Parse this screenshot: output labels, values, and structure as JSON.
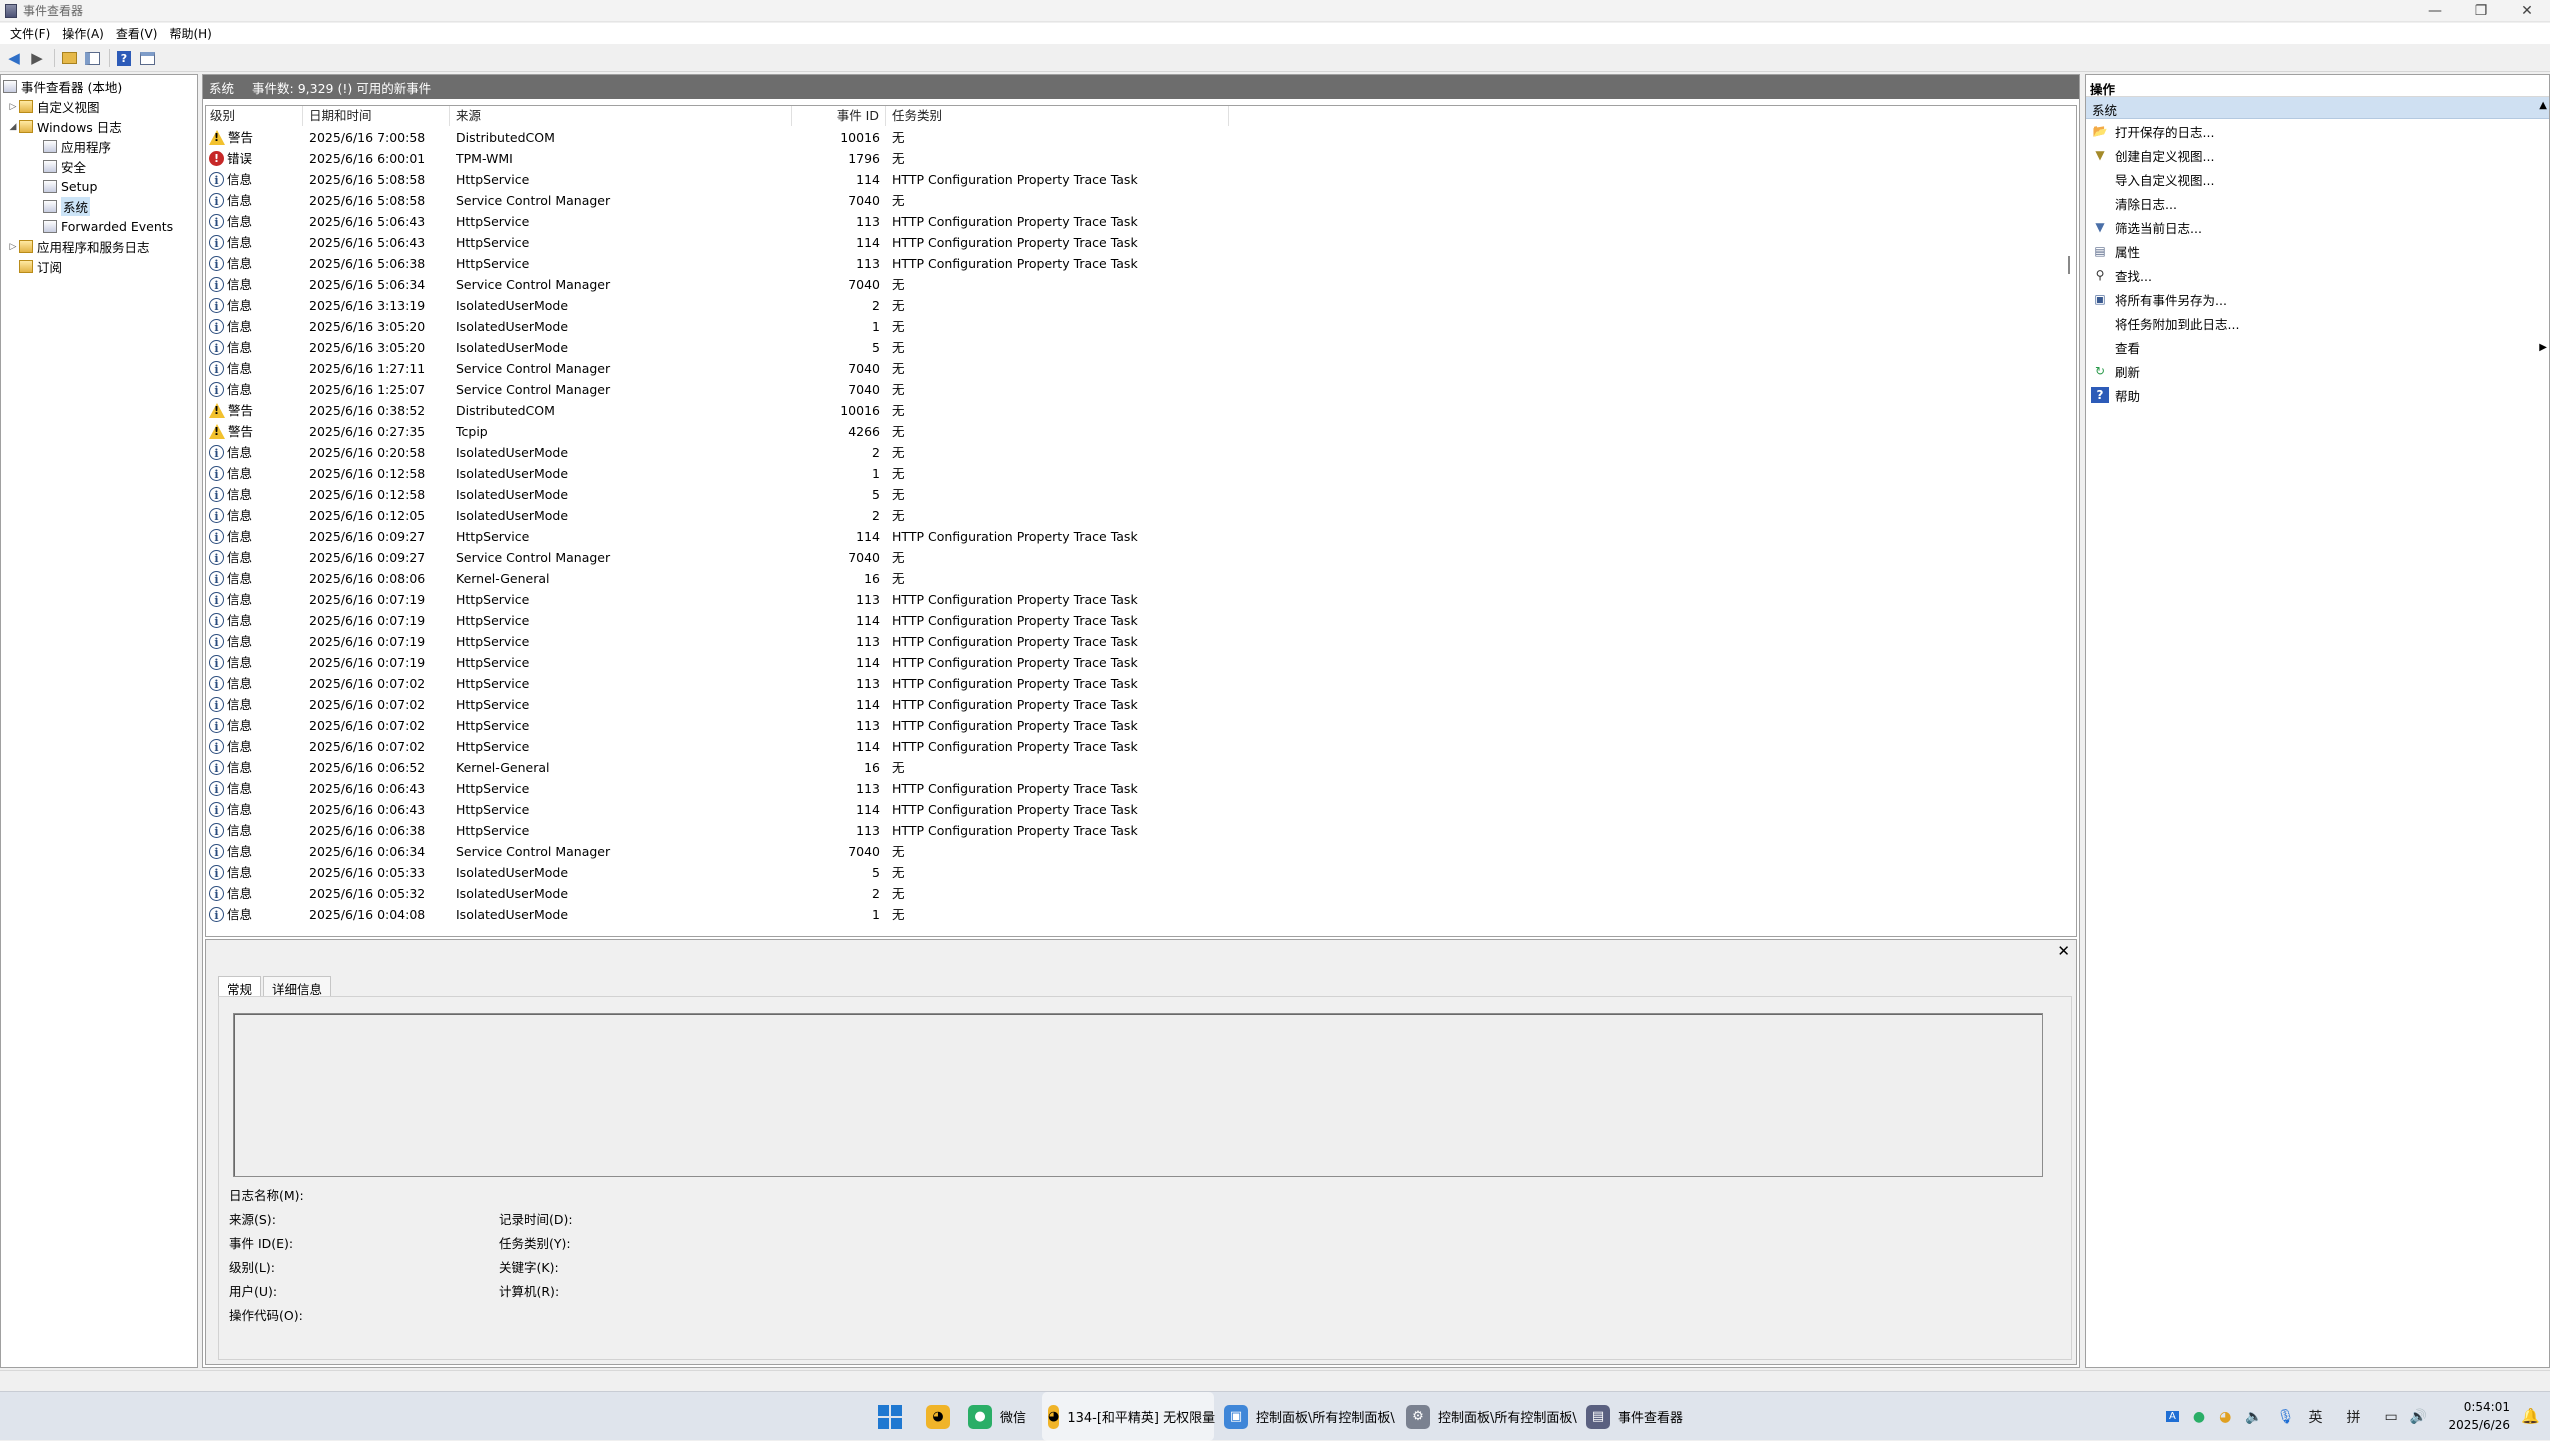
{
  "window": {
    "title": "事件查看器",
    "min": "—",
    "restore": "❐",
    "close": "✕"
  },
  "menu": [
    "文件(F)",
    "操作(A)",
    "查看(V)",
    "帮助(H)"
  ],
  "tree": {
    "root": "事件查看器 (本地)",
    "custom_views": "自定义视图",
    "windows_logs": "Windows 日志",
    "app": "应用程序",
    "security": "安全",
    "setup": "Setup",
    "system": "系统",
    "forwarded": "Forwarded Events",
    "app_services": "应用程序和服务日志",
    "subscriptions": "订阅"
  },
  "center": {
    "log_name": "系统",
    "summary": "事件数: 9,329 (!) 可用的新事件"
  },
  "columns": {
    "level": "级别",
    "datetime": "日期和时间",
    "source": "来源",
    "event_id": "事件 ID",
    "task": "任务类别"
  },
  "events": [
    {
      "level": "警告",
      "type": "warn",
      "datetime": "2025/6/16 7:00:58",
      "source": "DistributedCOM",
      "id": "10016",
      "task": "无"
    },
    {
      "level": "错误",
      "type": "err",
      "datetime": "2025/6/16 6:00:01",
      "source": "TPM-WMI",
      "id": "1796",
      "task": "无"
    },
    {
      "level": "信息",
      "type": "info",
      "datetime": "2025/6/16 5:08:58",
      "source": "HttpService",
      "id": "114",
      "task": "HTTP Configuration Property Trace Task"
    },
    {
      "level": "信息",
      "type": "info",
      "datetime": "2025/6/16 5:08:58",
      "source": "Service Control Manager",
      "id": "7040",
      "task": "无"
    },
    {
      "level": "信息",
      "type": "info",
      "datetime": "2025/6/16 5:06:43",
      "source": "HttpService",
      "id": "113",
      "task": "HTTP Configuration Property Trace Task"
    },
    {
      "level": "信息",
      "type": "info",
      "datetime": "2025/6/16 5:06:43",
      "source": "HttpService",
      "id": "114",
      "task": "HTTP Configuration Property Trace Task"
    },
    {
      "level": "信息",
      "type": "info",
      "datetime": "2025/6/16 5:06:38",
      "source": "HttpService",
      "id": "113",
      "task": "HTTP Configuration Property Trace Task"
    },
    {
      "level": "信息",
      "type": "info",
      "datetime": "2025/6/16 5:06:34",
      "source": "Service Control Manager",
      "id": "7040",
      "task": "无"
    },
    {
      "level": "信息",
      "type": "info",
      "datetime": "2025/6/16 3:13:19",
      "source": "IsolatedUserMode",
      "id": "2",
      "task": "无"
    },
    {
      "level": "信息",
      "type": "info",
      "datetime": "2025/6/16 3:05:20",
      "source": "IsolatedUserMode",
      "id": "1",
      "task": "无"
    },
    {
      "level": "信息",
      "type": "info",
      "datetime": "2025/6/16 3:05:20",
      "source": "IsolatedUserMode",
      "id": "5",
      "task": "无"
    },
    {
      "level": "信息",
      "type": "info",
      "datetime": "2025/6/16 1:27:11",
      "source": "Service Control Manager",
      "id": "7040",
      "task": "无"
    },
    {
      "level": "信息",
      "type": "info",
      "datetime": "2025/6/16 1:25:07",
      "source": "Service Control Manager",
      "id": "7040",
      "task": "无"
    },
    {
      "level": "警告",
      "type": "warn",
      "datetime": "2025/6/16 0:38:52",
      "source": "DistributedCOM",
      "id": "10016",
      "task": "无"
    },
    {
      "level": "警告",
      "type": "warn",
      "datetime": "2025/6/16 0:27:35",
      "source": "Tcpip",
      "id": "4266",
      "task": "无"
    },
    {
      "level": "信息",
      "type": "info",
      "datetime": "2025/6/16 0:20:58",
      "source": "IsolatedUserMode",
      "id": "2",
      "task": "无"
    },
    {
      "level": "信息",
      "type": "info",
      "datetime": "2025/6/16 0:12:58",
      "source": "IsolatedUserMode",
      "id": "1",
      "task": "无"
    },
    {
      "level": "信息",
      "type": "info",
      "datetime": "2025/6/16 0:12:58",
      "source": "IsolatedUserMode",
      "id": "5",
      "task": "无"
    },
    {
      "level": "信息",
      "type": "info",
      "datetime": "2025/6/16 0:12:05",
      "source": "IsolatedUserMode",
      "id": "2",
      "task": "无"
    },
    {
      "level": "信息",
      "type": "info",
      "datetime": "2025/6/16 0:09:27",
      "source": "HttpService",
      "id": "114",
      "task": "HTTP Configuration Property Trace Task"
    },
    {
      "level": "信息",
      "type": "info",
      "datetime": "2025/6/16 0:09:27",
      "source": "Service Control Manager",
      "id": "7040",
      "task": "无"
    },
    {
      "level": "信息",
      "type": "info",
      "datetime": "2025/6/16 0:08:06",
      "source": "Kernel-General",
      "id": "16",
      "task": "无"
    },
    {
      "level": "信息",
      "type": "info",
      "datetime": "2025/6/16 0:07:19",
      "source": "HttpService",
      "id": "113",
      "task": "HTTP Configuration Property Trace Task"
    },
    {
      "level": "信息",
      "type": "info",
      "datetime": "2025/6/16 0:07:19",
      "source": "HttpService",
      "id": "114",
      "task": "HTTP Configuration Property Trace Task"
    },
    {
      "level": "信息",
      "type": "info",
      "datetime": "2025/6/16 0:07:19",
      "source": "HttpService",
      "id": "113",
      "task": "HTTP Configuration Property Trace Task"
    },
    {
      "level": "信息",
      "type": "info",
      "datetime": "2025/6/16 0:07:19",
      "source": "HttpService",
      "id": "114",
      "task": "HTTP Configuration Property Trace Task"
    },
    {
      "level": "信息",
      "type": "info",
      "datetime": "2025/6/16 0:07:02",
      "source": "HttpService",
      "id": "113",
      "task": "HTTP Configuration Property Trace Task"
    },
    {
      "level": "信息",
      "type": "info",
      "datetime": "2025/6/16 0:07:02",
      "source": "HttpService",
      "id": "114",
      "task": "HTTP Configuration Property Trace Task"
    },
    {
      "level": "信息",
      "type": "info",
      "datetime": "2025/6/16 0:07:02",
      "source": "HttpService",
      "id": "113",
      "task": "HTTP Configuration Property Trace Task"
    },
    {
      "level": "信息",
      "type": "info",
      "datetime": "2025/6/16 0:07:02",
      "source": "HttpService",
      "id": "114",
      "task": "HTTP Configuration Property Trace Task"
    },
    {
      "level": "信息",
      "type": "info",
      "datetime": "2025/6/16 0:06:52",
      "source": "Kernel-General",
      "id": "16",
      "task": "无"
    },
    {
      "level": "信息",
      "type": "info",
      "datetime": "2025/6/16 0:06:43",
      "source": "HttpService",
      "id": "113",
      "task": "HTTP Configuration Property Trace Task"
    },
    {
      "level": "信息",
      "type": "info",
      "datetime": "2025/6/16 0:06:43",
      "source": "HttpService",
      "id": "114",
      "task": "HTTP Configuration Property Trace Task"
    },
    {
      "level": "信息",
      "type": "info",
      "datetime": "2025/6/16 0:06:38",
      "source": "HttpService",
      "id": "113",
      "task": "HTTP Configuration Property Trace Task"
    },
    {
      "level": "信息",
      "type": "info",
      "datetime": "2025/6/16 0:06:34",
      "source": "Service Control Manager",
      "id": "7040",
      "task": "无"
    },
    {
      "level": "信息",
      "type": "info",
      "datetime": "2025/6/16 0:05:33",
      "source": "IsolatedUserMode",
      "id": "5",
      "task": "无"
    },
    {
      "level": "信息",
      "type": "info",
      "datetime": "2025/6/16 0:05:32",
      "source": "IsolatedUserMode",
      "id": "2",
      "task": "无"
    },
    {
      "level": "信息",
      "type": "info",
      "datetime": "2025/6/16 0:04:08",
      "source": "IsolatedUserMode",
      "id": "1",
      "task": "无"
    }
  ],
  "detail": {
    "close": "✕",
    "tab_general": "常规",
    "tab_details": "详细信息",
    "fields": {
      "log_name": "日志名称(M):",
      "source": "来源(S):",
      "event_id": "事件 ID(E):",
      "level": "级别(L):",
      "user": "用户(U):",
      "opcode": "操作代码(O):",
      "logged": "记录时间(D):",
      "task": "任务类别(Y):",
      "keywords": "关键字(K):",
      "computer": "计算机(R):"
    }
  },
  "actions": {
    "header": "操作",
    "section": "系统",
    "items": [
      {
        "label": "打开保存的日志...",
        "icon": "folder-open-icon"
      },
      {
        "label": "创建自定义视图...",
        "icon": "filter-create-icon"
      },
      {
        "label": "导入自定义视图...",
        "icon": ""
      },
      {
        "label": "清除日志...",
        "icon": ""
      },
      {
        "label": "筛选当前日志...",
        "icon": "filter-icon"
      },
      {
        "label": "属性",
        "icon": "properties-icon"
      },
      {
        "label": "查找...",
        "icon": "find-icon"
      },
      {
        "label": "将所有事件另存为...",
        "icon": "save-icon"
      },
      {
        "label": "将任务附加到此日志...",
        "icon": ""
      },
      {
        "label": "查看",
        "icon": "",
        "submenu": true
      },
      {
        "label": "刷新",
        "icon": "refresh-icon"
      },
      {
        "label": "帮助",
        "icon": "help-icon"
      }
    ]
  },
  "taskbar": {
    "wechat": "微信",
    "game": "134-[和平精英] 无权限量",
    "cp1": "控制面板\\所有控制面板\\",
    "cp2": "控制面板\\所有控制面板\\",
    "eventviewer": "事件查看器",
    "ime1": "英",
    "ime2": "拼",
    "time": "0:54:01",
    "date": "2025/6/26"
  },
  "colors": {
    "accent": "#cce4f7",
    "header_bar": "#6d6d6d",
    "warn": "#f2c12e",
    "error": "#c62828",
    "info": "#2b4d7e"
  }
}
